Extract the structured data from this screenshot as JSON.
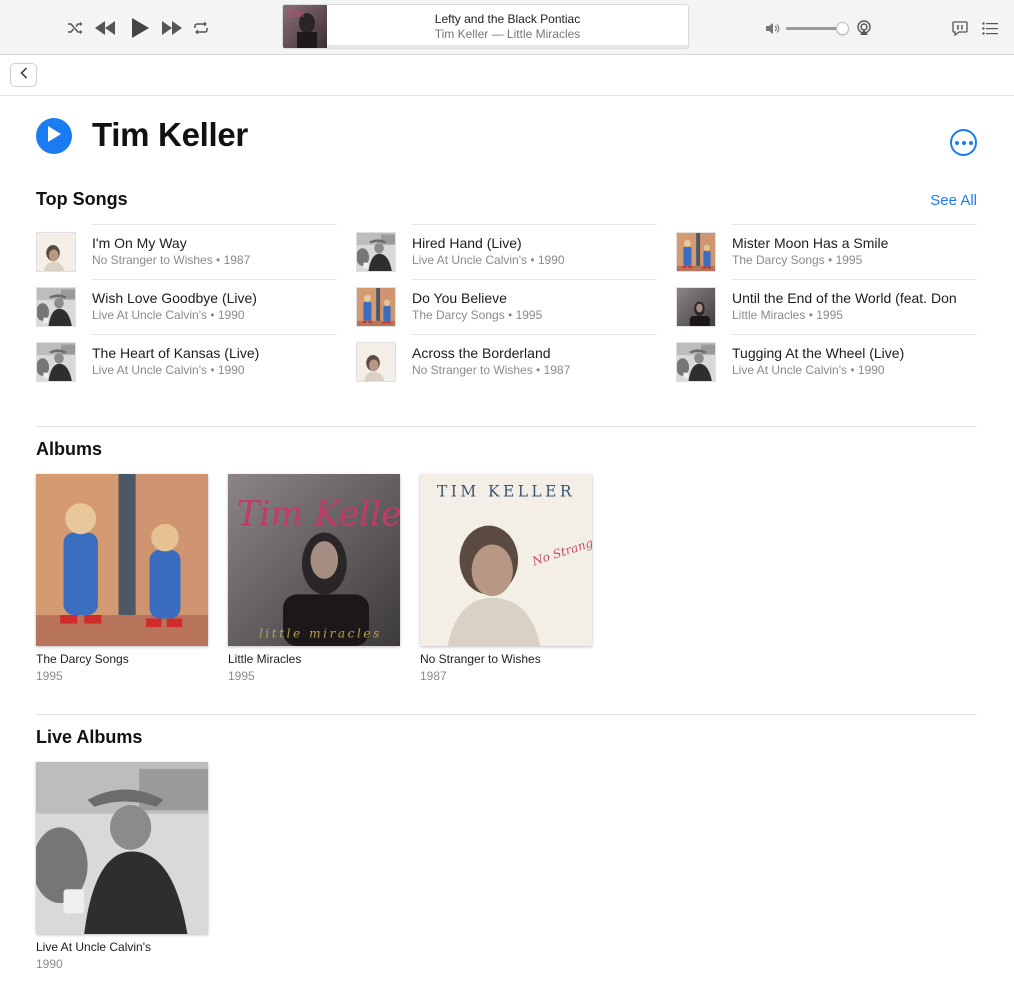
{
  "now_playing": {
    "title": "Lefty and the Black Pontiac",
    "subtitle": "Tim Keller — Little Miracles",
    "progress": 0.0
  },
  "volume": {
    "level": 0.92
  },
  "artist": {
    "name": "Tim Keller"
  },
  "top_songs": {
    "title": "Top Songs",
    "see_all": "See All",
    "items": [
      {
        "name": "I'm On My Way",
        "meta": "No Stranger to Wishes • 1987",
        "art": "no-stranger-art"
      },
      {
        "name": "Wish Love Goodbye (Live)",
        "meta": "Live At Uncle Calvin's • 1990",
        "art": "live-art"
      },
      {
        "name": "The Heart of Kansas (Live)",
        "meta": "Live At Uncle Calvin's • 1990",
        "art": "live-art"
      },
      {
        "name": "Hired Hand (Live)",
        "meta": "Live At Uncle Calvin's • 1990",
        "art": "live-art"
      },
      {
        "name": "Do You Believe",
        "meta": "The Darcy Songs • 1995",
        "art": "darcy-art"
      },
      {
        "name": "Across the Borderland",
        "meta": "No Stranger to Wishes • 1987",
        "art": "no-stranger-art"
      },
      {
        "name": "Mister Moon Has a Smile",
        "meta": "The Darcy Songs • 1995",
        "art": "darcy-art"
      },
      {
        "name": "Until the End of the World (feat. Don",
        "meta": "Little Miracles • 1995",
        "art": "miracles-art"
      },
      {
        "name": "Tugging At the Wheel (Live)",
        "meta": "Live At Uncle Calvin's • 1990",
        "art": "live-art"
      }
    ]
  },
  "albums": {
    "title": "Albums",
    "items": [
      {
        "title": "The Darcy Songs",
        "year": "1995",
        "art": "darcy-art"
      },
      {
        "title": "Little Miracles",
        "year": "1995",
        "art": "miracles-art",
        "cover_text": "Tim Keller",
        "cover_sub": "little miracles"
      },
      {
        "title": "No Stranger to Wishes",
        "year": "1987",
        "art": "no-stranger-art",
        "cover_text": "TIM KELLER",
        "cover_sub": "No Stranger to Wishes"
      }
    ]
  },
  "live_albums": {
    "title": "Live Albums",
    "items": [
      {
        "title": "Live At Uncle Calvin's",
        "year": "1990",
        "art": "live-art"
      }
    ]
  },
  "colors": {
    "accent": "#1a7cf0",
    "secondary_text": "#8a8a8a"
  }
}
